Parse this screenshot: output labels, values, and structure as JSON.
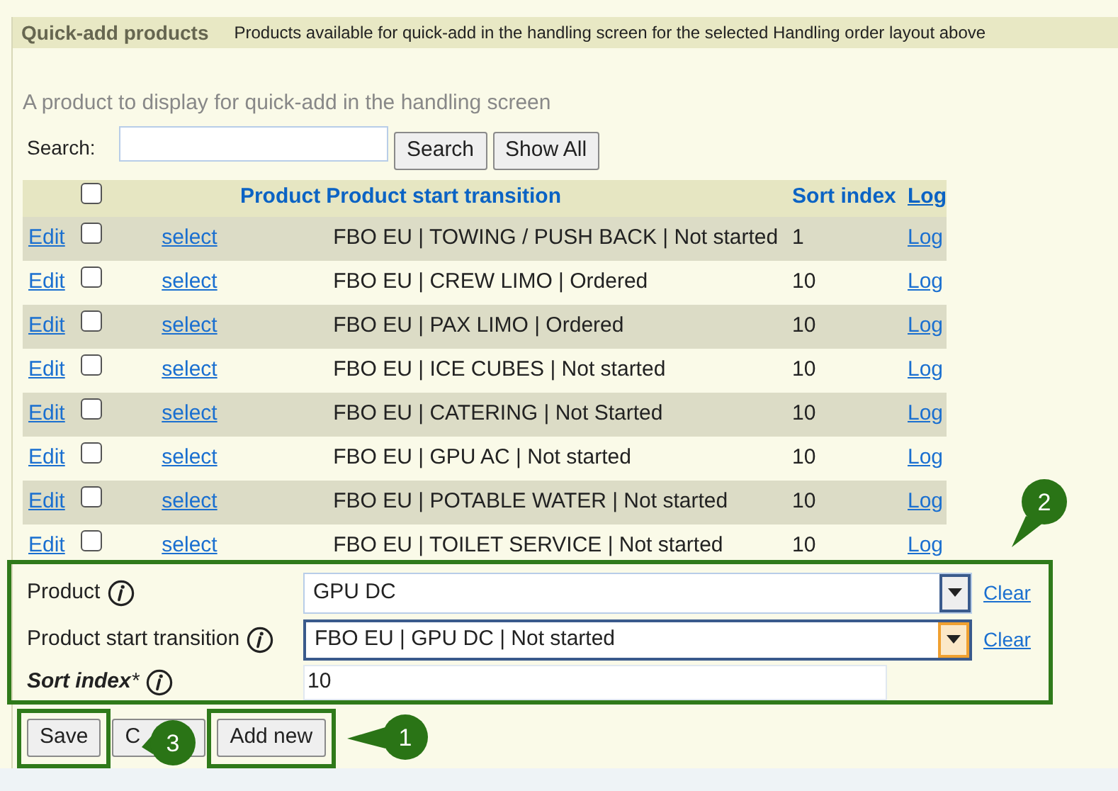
{
  "section": {
    "title": "Quick-add products",
    "description": "Products available for quick-add in the handling screen for the selected Handling order layout above"
  },
  "intro": "A product to display for quick-add in the handling screen",
  "search": {
    "label": "Search:",
    "buttons": [
      "Search",
      "Show All"
    ]
  },
  "table": {
    "columns": [
      "Product",
      "Product start transition",
      "Sort index",
      "Log"
    ],
    "select_all": {
      "checked": false
    },
    "rows": [
      {
        "edit": "Edit",
        "checked": false,
        "select": "select",
        "transition": "FBO EU | TOWING / PUSH BACK | Not started",
        "sort_index": "1",
        "log": "Log"
      },
      {
        "edit": "Edit",
        "checked": false,
        "select": "select",
        "transition": "FBO EU | CREW LIMO | Ordered",
        "sort_index": "10",
        "log": "Log"
      },
      {
        "edit": "Edit",
        "checked": false,
        "select": "select",
        "transition": "FBO EU | PAX LIMO | Ordered",
        "sort_index": "10",
        "log": "Log"
      },
      {
        "edit": "Edit",
        "checked": false,
        "select": "select",
        "transition": "FBO EU | ICE CUBES | Not started",
        "sort_index": "10",
        "log": "Log"
      },
      {
        "edit": "Edit",
        "checked": false,
        "select": "select",
        "transition": "FBO EU | CATERING | Not Started",
        "sort_index": "10",
        "log": "Log"
      },
      {
        "edit": "Edit",
        "checked": false,
        "select": "select",
        "transition": "FBO EU | GPU AC | Not started",
        "sort_index": "10",
        "log": "Log"
      },
      {
        "edit": "Edit",
        "checked": false,
        "select": "select",
        "transition": "FBO EU | POTABLE WATER | Not started",
        "sort_index": "10",
        "log": "Log"
      },
      {
        "edit": "Edit",
        "checked": false,
        "select": "select",
        "transition": "FBO EU | TOILET SERVICE | Not started",
        "sort_index": "10",
        "log": "Log"
      }
    ]
  },
  "form": {
    "callout": "2",
    "fields": [
      {
        "kind": "select",
        "label": "Product",
        "value": "GPU DC",
        "focused": false,
        "clear": "Clear"
      },
      {
        "kind": "select",
        "label": "Product start transition",
        "value": "FBO EU | GPU DC | Not started",
        "focused": true,
        "clear": "Clear"
      },
      {
        "kind": "text",
        "label": "Sort index",
        "required_mark": "*",
        "value": "10"
      }
    ]
  },
  "buttons": [
    {
      "label": "Save",
      "callout": "3"
    },
    {
      "label": "C"
    },
    {
      "label": "Add new",
      "callout": "1"
    }
  ]
}
